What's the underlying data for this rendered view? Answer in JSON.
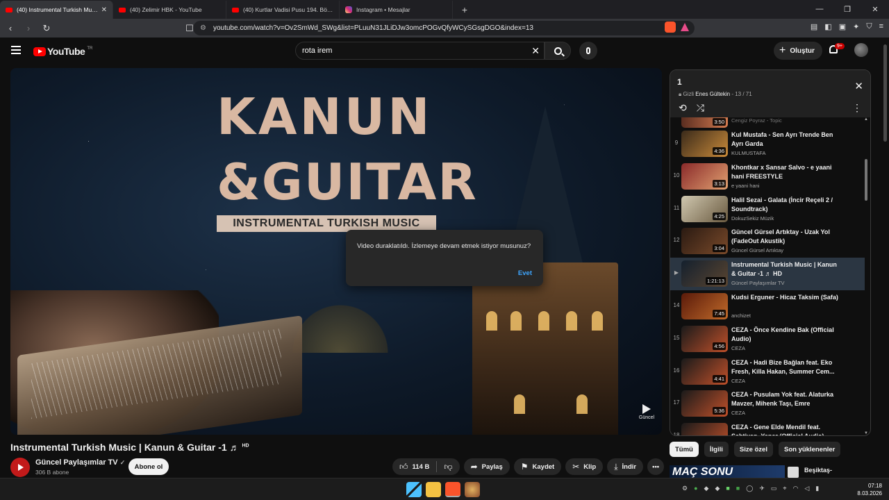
{
  "browser": {
    "tabs": [
      {
        "title": "(40) Instrumental Turkish Music",
        "active": true,
        "icon": "youtube-icon"
      },
      {
        "title": "(40) Zelimir HBK - YouTube",
        "active": false,
        "icon": "youtube-icon"
      },
      {
        "title": "(40) Kurtlar Vadisi Pusu 194. Bölüm -",
        "active": false,
        "icon": "youtube-icon"
      },
      {
        "title": "Instagram • Mesajlar",
        "active": false,
        "icon": "instagram-icon"
      }
    ],
    "url": "youtube.com/watch?v=Ov2SmWd_SWg&list=PLuuN31JLiDJw3omcPOGvQfyWCySGsgDGO&index=13"
  },
  "header": {
    "logo_text": "YouTube",
    "logo_region": "TR",
    "search_value": "rota irem",
    "create_label": "Oluştur",
    "notif_badge": "9+"
  },
  "player": {
    "overlay_line1": "KANUN",
    "overlay_line2": "&GUITAR",
    "overlay_banner": "INSTRUMENTAL TURKISH MUSIC",
    "watermark": "Güncel",
    "dialog_message": "Video duraklatıldı. İzlemeye devam etmek istiyor musunuz?",
    "dialog_yes": "Evet"
  },
  "video": {
    "title": "Instrumental Turkish Music | Kanun & Guitar -1 ♬",
    "title_hd": "HD",
    "channel": "Güncel Paylaşımlar TV",
    "subscribers": "306 B abone",
    "subscribe_label": "Abone ol",
    "likes": "114 B",
    "share_label": "Paylaş",
    "save_label": "Kaydet",
    "clip_label": "Klip",
    "download_label": "İndir"
  },
  "playlist": {
    "title": "1",
    "privacy": "Gizli",
    "owner": "Enes Gültekin",
    "position": "13 / 71",
    "top_partial_author": "Cengiz Poyraz - Topic",
    "top_partial_duration": "3:50",
    "items": [
      {
        "index": "9",
        "title": "Kul Mustafa - Sen Ayrı Trende Ben Ayrı Garda",
        "author": "KULMUSTAFA",
        "duration": "4:36",
        "c1": "#3a2a1a",
        "c2": "#c98a3a"
      },
      {
        "index": "10",
        "title": "Khontkar x Sansar Salvo - e yaani hani FREESTYLE",
        "author": "e yaani hani",
        "duration": "3:13",
        "c1": "#8a2a2a",
        "c2": "#e0a070"
      },
      {
        "index": "11",
        "title": "Halil Sezai - Galata (İncir Reçeli 2 / Soundtrack)",
        "author": "DokuzSekiz Müzik",
        "duration": "4:25",
        "c1": "#d0c8b0",
        "c2": "#6a5a40"
      },
      {
        "index": "12",
        "title": "Güncel Gürsel Artıktay - Uzak Yol (FadeOut Akustik)",
        "author": "Güncel Gürsel Artıktay",
        "duration": "3:04",
        "c1": "#2a1a12",
        "c2": "#7a4a2a"
      },
      {
        "index": "▶",
        "title": "Instrumental Turkish Music | Kanun & Guitar -1 ♬ HD",
        "author": "Güncel Paylaşımlar TV",
        "duration": "1:21:13",
        "c1": "#14202e",
        "c2": "#5a4530",
        "current": true
      },
      {
        "index": "14",
        "title": "Kudsi Erguner - Hicaz Taksim (Safa)",
        "author": "anchizet",
        "duration": "7:45",
        "c1": "#5a1a0a",
        "c2": "#c06a2a"
      },
      {
        "index": "15",
        "title": "CEZA - Önce Kendine Bak (Official Audio)",
        "author": "CEZA",
        "duration": "4:56",
        "c1": "#1a1a1a",
        "c2": "#c0502a"
      },
      {
        "index": "16",
        "title": "CEZA - Hadi Bize Bağlan feat. Eko Fresh, Killa Hakan, Summer Cem...",
        "author": "CEZA",
        "duration": "4:41",
        "c1": "#1a1a1a",
        "c2": "#c0502a"
      },
      {
        "index": "17",
        "title": "CEZA - Pusulam Yok feat. Alaturka Mavzer, Mihenk Taşı, Emre (Official...",
        "author": "CEZA",
        "duration": "5:36",
        "c1": "#1a1a1a",
        "c2": "#c0502a"
      },
      {
        "index": "18",
        "title": "CEZA - Gene Elde Mendil feat. Sahtiyan, Yener (Official Audio)",
        "author": "CEZA",
        "duration": "",
        "c1": "#1a1a1a",
        "c2": "#c0502a"
      }
    ]
  },
  "chips": [
    "Tümü",
    "İlgili",
    "Size özel",
    "Son yüklenenler"
  ],
  "recommendation": {
    "thumb_text": "MAÇ SONU",
    "title": "Beşiktaş-"
  },
  "taskbar": {
    "time": "07:18",
    "date": "8.03.2026"
  }
}
